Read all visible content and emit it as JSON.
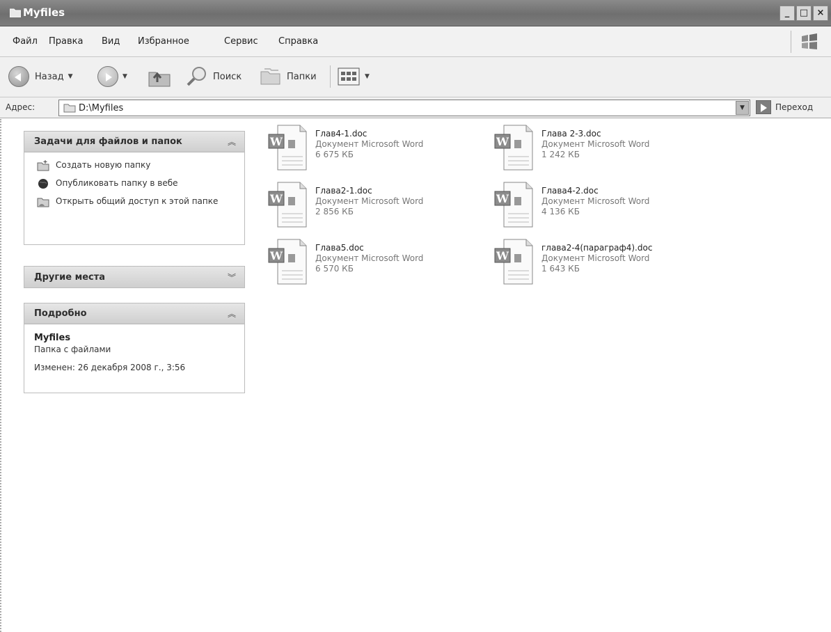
{
  "window": {
    "title": "Myfiles",
    "icon": "folder-icon",
    "buttons": [
      "_",
      "□",
      "×"
    ]
  },
  "menu": {
    "items": [
      "Файл",
      "Правка",
      "Вид",
      "Избранное",
      "Сервис",
      "Справка"
    ],
    "flag_icon": "windows-flag-icon"
  },
  "toolbar": {
    "back_label": "Назад",
    "search_label": "Поиск",
    "folders_label": "Папки",
    "icons": [
      "back-arrow-icon",
      "forward-arrow-icon",
      "up-folder-icon",
      "search-icon",
      "folders-icon",
      "view-icon"
    ]
  },
  "address": {
    "label": "Адрес:",
    "value": "D:\\Myfiles",
    "go_label": "Переход"
  },
  "tasks_panel": {
    "title": "Задачи для файлов и папок",
    "items": [
      {
        "label": "Создать новую папку",
        "icon": "new-folder-icon"
      },
      {
        "label": "Опубликовать папку в вебе",
        "icon": "globe-icon"
      },
      {
        "label": "Открыть общий доступ к этой папке",
        "icon": "share-folder-icon"
      }
    ]
  },
  "places_panel": {
    "title": "Другие места"
  },
  "details_panel": {
    "title": "Подробно",
    "name": "Myfiles",
    "type": "Папка с файлами",
    "modified": "Изменен: 26 декабря 2008 г., 3:56"
  },
  "files": [
    {
      "name": "Глав4-1.doc",
      "type": "Документ Microsoft Word",
      "size": "6 675 КБ"
    },
    {
      "name": "Глава 2-3.doc",
      "type": "Документ Microsoft Word",
      "size": "1 242 КБ"
    },
    {
      "name": "Глава2-1.doc",
      "type": "Документ Microsoft Word",
      "size": "2 856 КБ"
    },
    {
      "name": "Глава4-2.doc",
      "type": "Документ Microsoft Word",
      "size": "4 136 КБ"
    },
    {
      "name": "Глава5.doc",
      "type": "Документ Microsoft Word",
      "size": "6 570 КБ"
    },
    {
      "name": "глава2-4(параграф4).doc",
      "type": "Документ Microsoft Word",
      "size": "1 643 КБ"
    }
  ]
}
